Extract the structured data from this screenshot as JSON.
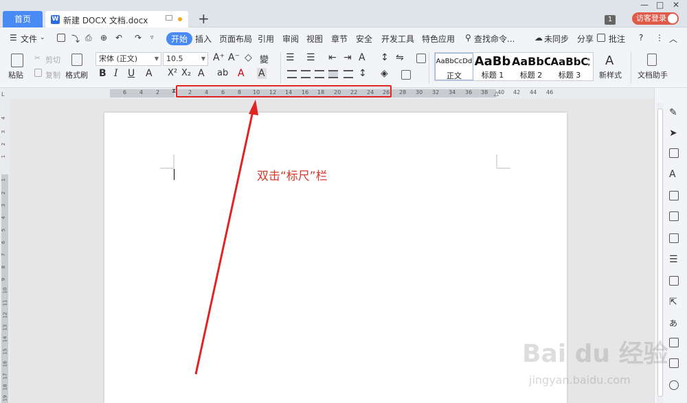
{
  "tabs": {
    "home": "首页",
    "document": "新建 DOCX 文档.docx",
    "badge": "1",
    "login": "访客登录"
  },
  "menu": {
    "file": "文件",
    "items": [
      "开始",
      "插入",
      "页面布局",
      "引用",
      "审阅",
      "视图",
      "章节",
      "安全",
      "开发工具",
      "特色应用"
    ],
    "search": "查找命令...",
    "sync": "未同步",
    "share": "分享",
    "comment": "批注"
  },
  "toolbar": {
    "paste": "粘贴",
    "cut": "剪切",
    "copy": "复制",
    "format_painter": "格式刷",
    "font_name": "宋体 (正文)",
    "font_size": "10.5",
    "styles": [
      {
        "preview": "AaBbCcDd",
        "name": "正文"
      },
      {
        "preview": "AaBb",
        "name": "标题 1"
      },
      {
        "preview": "AaBbC",
        "name": "标题 2"
      },
      {
        "preview": "AaBbC",
        "name": "标题 3"
      }
    ],
    "new_style": "新样式",
    "doc_assistant": "文档助手"
  },
  "ruler": {
    "left_numbers": [
      "6",
      "4",
      "2"
    ],
    "right_numbers": [
      "2",
      "4",
      "6",
      "8",
      "10",
      "12",
      "14",
      "16",
      "18",
      "20",
      "22",
      "24",
      "26",
      "28",
      "30",
      "32",
      "34",
      "36",
      "38",
      "40",
      "42",
      "44",
      "46"
    ]
  },
  "vruler_numbers": [
    "4",
    "3",
    "2",
    "1",
    "1",
    "2",
    "3",
    "4",
    "5",
    "6",
    "7",
    "8",
    "9",
    "10",
    "11",
    "12",
    "13",
    "14",
    "15",
    "16",
    "17",
    "18",
    "19"
  ],
  "annotation": "双击“标尺”栏",
  "watermark": {
    "main": "Bai du 经验",
    "url": "jingyan.baidu.com"
  }
}
